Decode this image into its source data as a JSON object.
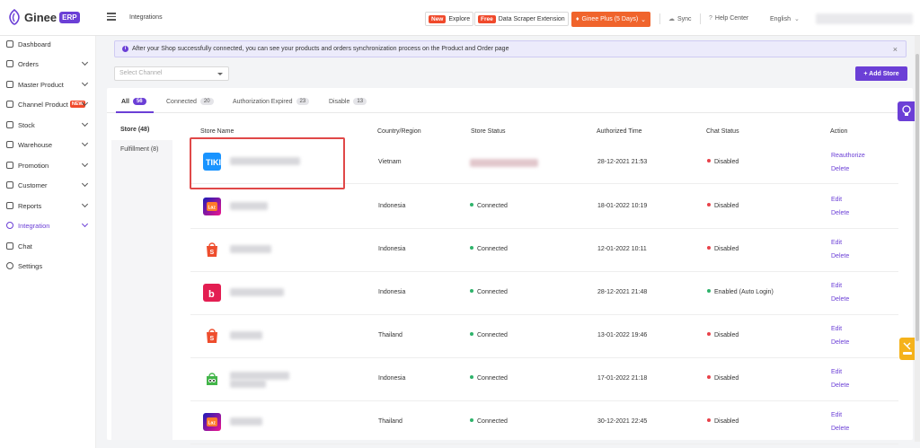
{
  "app": {
    "logo_text": "Ginee",
    "logo_badge": "ERP",
    "breadcrumb": "Integrations"
  },
  "topbar": {
    "explore_badge": "New",
    "explore_label": "Explore",
    "scraper_badge": "Free",
    "scraper_label": "Data Scraper Extension",
    "plus_label": "Ginee Plus (5 Days)",
    "sync_label": "Sync",
    "help_label": "Help Center",
    "language": "English"
  },
  "sidebar": {
    "items": [
      {
        "label": "Dashboard",
        "icon": "dashboard-icon"
      },
      {
        "label": "Orders",
        "icon": "cart-icon"
      },
      {
        "label": "Master Product",
        "icon": "box-icon"
      },
      {
        "label": "Channel Product",
        "icon": "store-icon",
        "badge": "NEW"
      },
      {
        "label": "Stock",
        "icon": "stock-icon"
      },
      {
        "label": "Warehouse",
        "icon": "warehouse-icon"
      },
      {
        "label": "Promotion",
        "icon": "tag-icon"
      },
      {
        "label": "Customer",
        "icon": "users-icon"
      },
      {
        "label": "Reports",
        "icon": "report-icon"
      },
      {
        "label": "Integration",
        "icon": "integration-icon"
      },
      {
        "label": "Chat",
        "icon": "chat-icon"
      },
      {
        "label": "Settings",
        "icon": "gear-icon"
      }
    ]
  },
  "alert": {
    "text": "After your Shop successfully connected, you can see your products and orders synchronization process on the Product and Order page",
    "close": "×"
  },
  "filters": {
    "channel_placeholder": "Select Channel",
    "add_store_label": "+ Add Store"
  },
  "tabs": [
    {
      "label": "All",
      "count": "56"
    },
    {
      "label": "Connected",
      "count": "20"
    },
    {
      "label": "Authorization Expired",
      "count": "23"
    },
    {
      "label": "Disable",
      "count": "13"
    }
  ],
  "subnav": [
    {
      "label": "Store (48)"
    },
    {
      "label": "Fulfillment (8)"
    }
  ],
  "table": {
    "headers": [
      "Store Name",
      "Country/Region",
      "Store Status",
      "Authorized Time",
      "Chat Status",
      "Action"
    ],
    "rows": [
      {
        "channel": "tiki",
        "country": "Vietnam",
        "status": "",
        "time": "28-12-2021 21:53",
        "chat": "Disabled",
        "actions": [
          "Reauthorize",
          "Delete"
        ]
      },
      {
        "channel": "lazada",
        "country": "Indonesia",
        "status": "Connected",
        "time": "18-01-2022 10:19",
        "chat": "Disabled",
        "actions": [
          "Edit",
          "Delete"
        ]
      },
      {
        "channel": "shopee",
        "country": "Indonesia",
        "status": "Connected",
        "time": "12-01-2022 10:11",
        "chat": "Disabled",
        "actions": [
          "Edit",
          "Delete"
        ]
      },
      {
        "channel": "bukalapak",
        "country": "Indonesia",
        "status": "Connected",
        "time": "28-12-2021 21:48",
        "chat": "Enabled (Auto Login)",
        "actions": [
          "Edit",
          "Delete"
        ]
      },
      {
        "channel": "shopee",
        "country": "Thailand",
        "status": "Connected",
        "time": "13-01-2022 19:46",
        "chat": "Disabled",
        "actions": [
          "Edit",
          "Delete"
        ]
      },
      {
        "channel": "tokopedia",
        "country": "Indonesia",
        "status": "Connected",
        "time": "17-01-2022 21:18",
        "chat": "Disabled",
        "actions": [
          "Edit",
          "Delete"
        ]
      },
      {
        "channel": "lazada",
        "country": "Thailand",
        "status": "Connected",
        "time": "30-12-2021 22:45",
        "chat": "Disabled",
        "actions": [
          "Edit",
          "Delete"
        ]
      }
    ]
  },
  "colors": {
    "accent": "#6b3fd6",
    "connected": "#2fb36b",
    "disabled": "#e8424a",
    "plus": "#f0642c"
  }
}
